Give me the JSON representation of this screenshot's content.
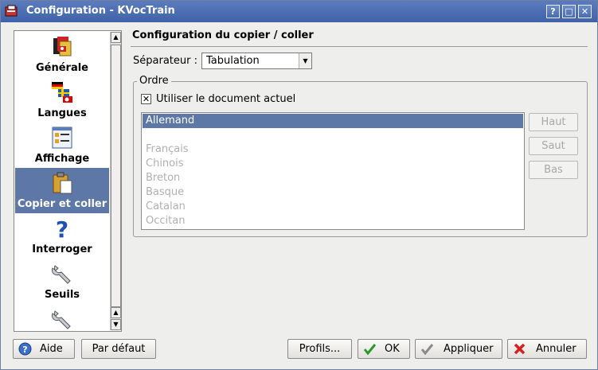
{
  "window": {
    "title": "Configuration - KVocTrain",
    "help_btn": "?",
    "max_btn": "□",
    "close_btn": "✕"
  },
  "sidebar": {
    "items": [
      {
        "label": "Générale"
      },
      {
        "label": "Langues"
      },
      {
        "label": "Affichage"
      },
      {
        "label": "Copier et coller"
      },
      {
        "label": "Interroger"
      },
      {
        "label": "Seuils"
      }
    ]
  },
  "main": {
    "title": "Configuration du copier / coller",
    "separator_label": "Séparateur :",
    "separator_value": "Tabulation",
    "group_title": "Ordre",
    "use_current_doc_label": "Utiliser le document actuel",
    "use_current_doc_checked": "✕",
    "languages": [
      "Allemand",
      "",
      "Français",
      "Chinois",
      "Breton",
      "Basque",
      "Catalan",
      "Occitan"
    ],
    "up": "Haut",
    "jump": "Saut",
    "down": "Bas"
  },
  "footer": {
    "help": "Aide",
    "default": "Par défaut",
    "profiles": "Profils...",
    "ok": "OK",
    "apply": "Appliquer",
    "cancel": "Annuler"
  },
  "colors": {
    "selection": "#5d77a7",
    "titlebar": "#4a6cb0"
  }
}
